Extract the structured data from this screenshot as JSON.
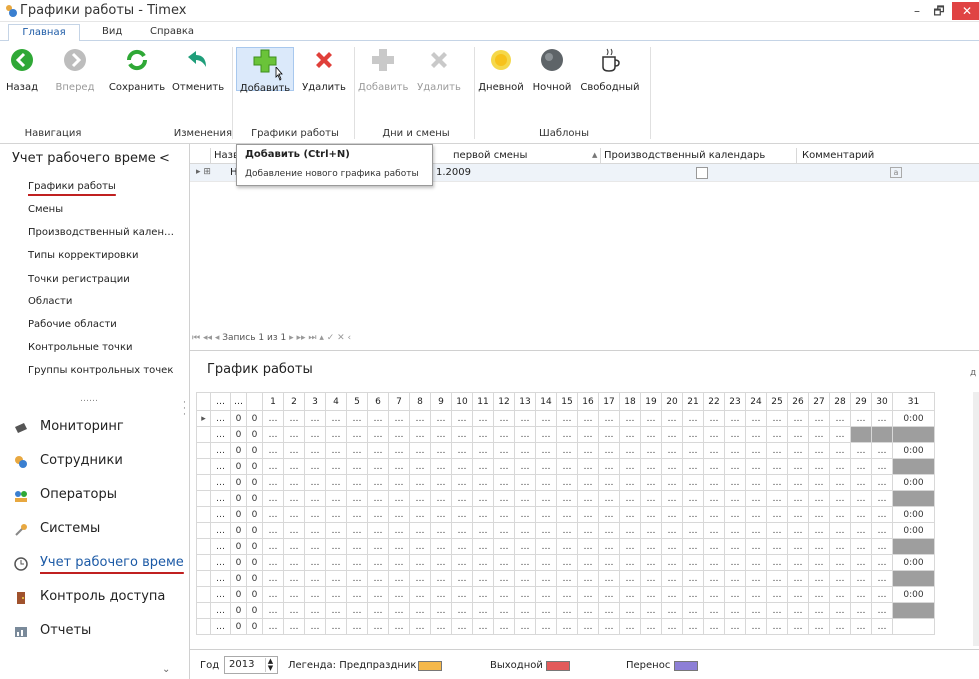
{
  "window": {
    "title": "Графики работы - Timex",
    "min": "–",
    "restore": "🗗",
    "close": "✕"
  },
  "ribbon_tabs": [
    "Главная",
    "Вид",
    "Справка"
  ],
  "ribbon": {
    "buttons": {
      "back": "Назад",
      "forward": "Вперед",
      "save": "Сохранить",
      "cancel": "Отменить",
      "add": "Добавить",
      "delete": "Удалить",
      "add_day": "Добавить",
      "delete_day": "Удалить",
      "day": "Дневной",
      "night": "Ночной",
      "free": "Свободный"
    },
    "groups": [
      "Навигация",
      "Изменения",
      "Графики работы",
      "Дни и смены",
      "Шаблоны"
    ]
  },
  "tooltip": {
    "title": "Добавить (Ctrl+N)",
    "description": "Добавление нового графика работы"
  },
  "nav": {
    "header": "Учет рабочего време",
    "collapse": "<",
    "items": [
      "Графики работы",
      "Смены",
      "Производственный кален…",
      "Типы корректировки",
      "Точки регистрации",
      "Области",
      "Рабочие области",
      "Контрольные точки",
      "Группы контрольных точек"
    ],
    "dots": "……",
    "modules": [
      "Мониторинг",
      "Сотрудники",
      "Операторы",
      "Системы",
      "Учет рабочего време",
      "Контроль доступа",
      "Отчеты"
    ],
    "more": "⌄"
  },
  "grid": {
    "headers": {
      "name": "Назв",
      "first_shift": "первой смены",
      "calendar": "Производственный календарь",
      "comment": "Комментарий"
    },
    "sort_mark": "▲",
    "row": {
      "expand": "▸ ⊞",
      "name": "На",
      "date": "1.2009",
      "memo": "a"
    }
  },
  "pager": {
    "text": "Запись 1 из 1"
  },
  "schedule": {
    "title": "График работы",
    "right_label": "д",
    "days": [
      "1",
      "2",
      "3",
      "4",
      "5",
      "6",
      "7",
      "8",
      "9",
      "10",
      "11",
      "12",
      "13",
      "14",
      "15",
      "16",
      "17",
      "18",
      "19",
      "20",
      "21",
      "22",
      "23",
      "24",
      "25",
      "26",
      "27",
      "28",
      "29",
      "30",
      "31"
    ],
    "row_values": [
      "0",
      "0",
      "0",
      "0",
      "0",
      "0",
      "0",
      "0",
      "0",
      "0",
      "0",
      "0",
      "0",
      "0"
    ],
    "cell_placeholder": "…",
    "hours_value": "0:00",
    "hours_rows": [
      0,
      2,
      4,
      6,
      7,
      9,
      11
    ],
    "grey_rows": [
      1,
      3,
      5,
      8,
      10,
      12
    ],
    "partial_row": "0:00"
  },
  "footer": {
    "year_label": "Год",
    "year": "2013",
    "legend_label": "Легенда: Предпраздник",
    "holiday": "Выходной",
    "transfer": "Перенос",
    "colors": {
      "pre": "#f5b84a",
      "holiday": "#e35a5a",
      "transfer": "#8d7fd6"
    }
  }
}
